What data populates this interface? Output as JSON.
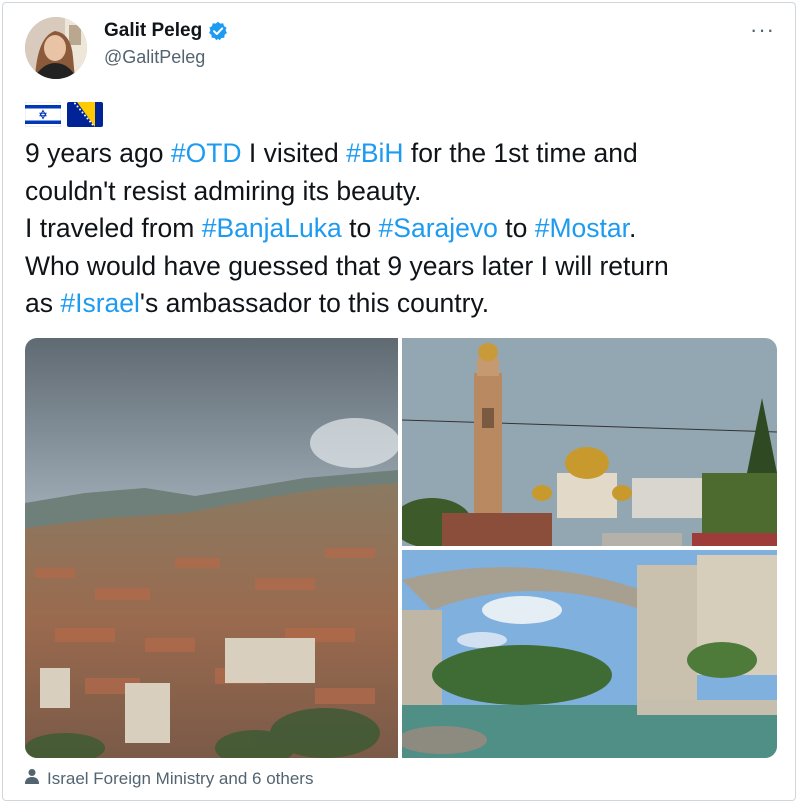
{
  "author": {
    "display_name": "Galit Peleg",
    "handle": "@GalitPeleg",
    "verified_icon": "verified-badge-icon",
    "avatar_icon": "user-avatar"
  },
  "menu": {
    "more_label": "···"
  },
  "flags": [
    "israel-flag-icon",
    "bosnia-flag-icon"
  ],
  "tweet": {
    "lines": [
      [
        {
          "t": "9 years ago "
        },
        {
          "t": "#OTD",
          "tag": true
        },
        {
          "t": " I visited "
        },
        {
          "t": "#BiH",
          "tag": true
        },
        {
          "t": " for the 1st time and"
        }
      ],
      [
        {
          "t": "couldn't resist admiring its beauty."
        }
      ],
      [
        {
          "t": " I traveled from "
        },
        {
          "t": "#BanjaLuka",
          "tag": true
        },
        {
          "t": " to "
        },
        {
          "t": "#Sarajevo",
          "tag": true
        },
        {
          "t": " to "
        },
        {
          "t": "#Mostar",
          "tag": true
        },
        {
          "t": "."
        }
      ],
      [
        {
          "t": "Who would have guessed that 9 years later I will return"
        }
      ],
      [
        {
          "t": "as "
        },
        {
          "t": "#Israel",
          "tag": true
        },
        {
          "t": "'s ambassador to this country."
        }
      ]
    ]
  },
  "media": {
    "images": [
      "sarajevo-city-photo",
      "banja-luka-church-photo",
      "mostar-bridge-photo"
    ]
  },
  "footer": {
    "icon": "person-icon",
    "text": "Israel Foreign Ministry and 6 others"
  },
  "colors": {
    "link": "#1d9bf0",
    "text": "#0f1419",
    "secondary": "#536471",
    "verified": "#1d9bf0"
  }
}
